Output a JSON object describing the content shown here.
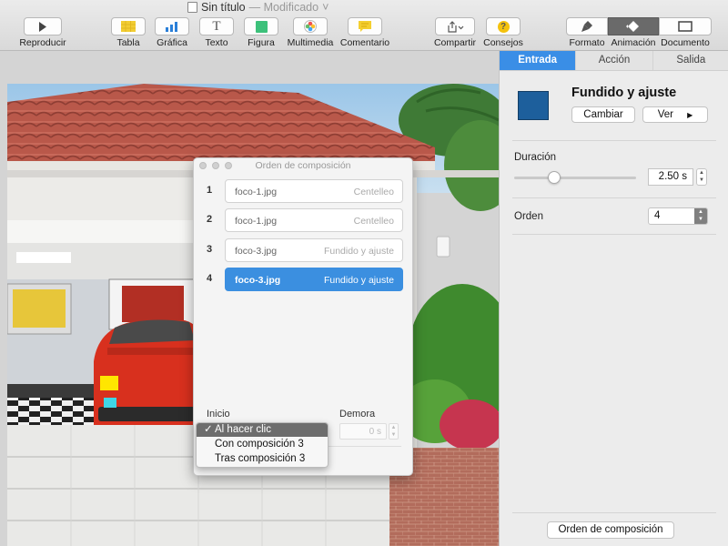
{
  "window": {
    "title": "Sin título",
    "status": "— Modificado",
    "status_chevron": "˅"
  },
  "toolbar": {
    "items": [
      {
        "id": "play",
        "label": "Reproducir",
        "icon": "play-icon"
      },
      {
        "id": "table",
        "label": "Tabla",
        "icon": "table-icon"
      },
      {
        "id": "chart",
        "label": "Gráfica",
        "icon": "chart-icon"
      },
      {
        "id": "text",
        "label": "Texto",
        "icon": "text-icon"
      },
      {
        "id": "shape",
        "label": "Figura",
        "icon": "shape-icon"
      },
      {
        "id": "media",
        "label": "Multimedia",
        "icon": "media-icon"
      },
      {
        "id": "comment",
        "label": "Comentario",
        "icon": "comment-icon"
      },
      {
        "id": "share",
        "label": "Compartir",
        "icon": "share-icon"
      },
      {
        "id": "tips",
        "label": "Consejos",
        "icon": "tips-icon"
      },
      {
        "id": "format",
        "label": "Formato",
        "icon": "format-brush-icon"
      },
      {
        "id": "animate",
        "label": "Animación",
        "icon": "animate-diamond-icon",
        "active": true
      },
      {
        "id": "document",
        "label": "Documento",
        "icon": "document-icon"
      }
    ],
    "text_glyph": "T",
    "tips_glyph": "?"
  },
  "build_panel": {
    "title": "Orden de composición",
    "builds": [
      {
        "number": "1",
        "file": "foco-1.jpg",
        "effect": "Centelleo"
      },
      {
        "number": "2",
        "file": "foco-1.jpg",
        "effect": "Centelleo"
      },
      {
        "number": "3",
        "file": "foco-3.jpg",
        "effect": "Fundido y ajuste"
      },
      {
        "number": "4",
        "file": "foco-3.jpg",
        "effect": "Fundido y ajuste",
        "selected": true
      }
    ],
    "start_label": "Inicio",
    "delay_label": "Demora",
    "delay_value": "0 s",
    "start_options": [
      "Al hacer clic",
      "Con composición 3",
      "Tras composición 3"
    ],
    "start_selected": "Al hacer clic",
    "check_mark": "✓"
  },
  "inspector": {
    "tabs": [
      {
        "label": "Entrada",
        "active": true
      },
      {
        "label": "Acción"
      },
      {
        "label": "Salida"
      }
    ],
    "effect_name": "Fundido y ajuste",
    "change_button": "Cambiar",
    "preview_button": "Ver",
    "preview_glyph": "▶",
    "duration_label": "Duración",
    "duration_value": "2.50 s",
    "order_label": "Orden",
    "order_value": "4",
    "build_order_button": "Orden de composición",
    "stepper_up": "▲",
    "stepper_down": "▼"
  },
  "colors": {
    "accent": "#3a8ee6",
    "effect_thumb": "#1d5f9c",
    "car_red": "#d8301e",
    "marker_yellow": "#ffe600",
    "marker_cyan": "#3fd6e6"
  }
}
